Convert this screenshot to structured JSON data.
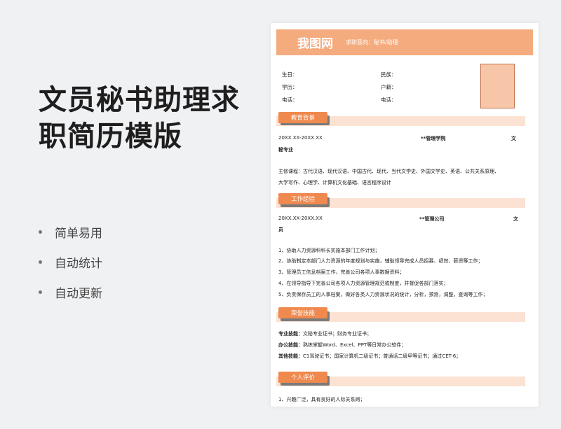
{
  "promo": {
    "title": "文员秘书助理求职简历模版",
    "features": [
      "简单易用",
      "自动统计",
      "自动更新"
    ]
  },
  "resume": {
    "brand": "我图网",
    "objective": "求职意向：秘书/助理",
    "info": {
      "birth": "生日：",
      "ethnicity": "民族：",
      "education": "学历：",
      "hukou": "户籍：",
      "phone1": "电话：",
      "phone2": "电话："
    },
    "sections": {
      "education": "教育背景",
      "work": "工作经验",
      "skills": "荣誉技能",
      "self": "个人评价"
    },
    "education": {
      "date": "20XX.XX-20XX.XX",
      "school": "**管理学院",
      "major_a": "文",
      "major_b": "秘专业",
      "courses_1": "主修课程：古代汉语、现代汉语、中国古代、现代、当代文学史、外国文学史、英语、公共关系原理、",
      "courses_2": "大学写作、心理学、计算机文化基础、语言程序设计"
    },
    "work": {
      "date": "20XX.XX-20XX.XX",
      "company": "**管理公司",
      "role_a": "文",
      "role_b": "员",
      "duties": [
        "1、协助人力资源科科长实施本部门工作计划；",
        "2、协助制定本部门人力资源的年度规划与实施，辅助领导完成人员招募、绩效、薪资等工作；",
        "3、管理员工信息档案工作，完善公司各项人事数据资料；",
        "4、在领导指导下完善公司各项人力资源管理规范或制度，并督促各部门落实；",
        "5、负责保存员工的人事档案，做好各类人力资源状况的统计，分析，预测，调整，查询等工作；"
      ]
    },
    "skills": [
      {
        "label": "专业技能：",
        "value": "文秘专业证书；财务专业证书；"
      },
      {
        "label": "办公技能：",
        "value": "熟练掌握Word、Excel、PPT等日常办公软件；"
      },
      {
        "label": "其他技能：",
        "value": "C1驾驶证书；国家计算机二级证书；普通话二级甲等证书；通过CET-6；"
      }
    ],
    "self_eval": "1、兴趣广泛，具有良好的人际关系网；"
  }
}
